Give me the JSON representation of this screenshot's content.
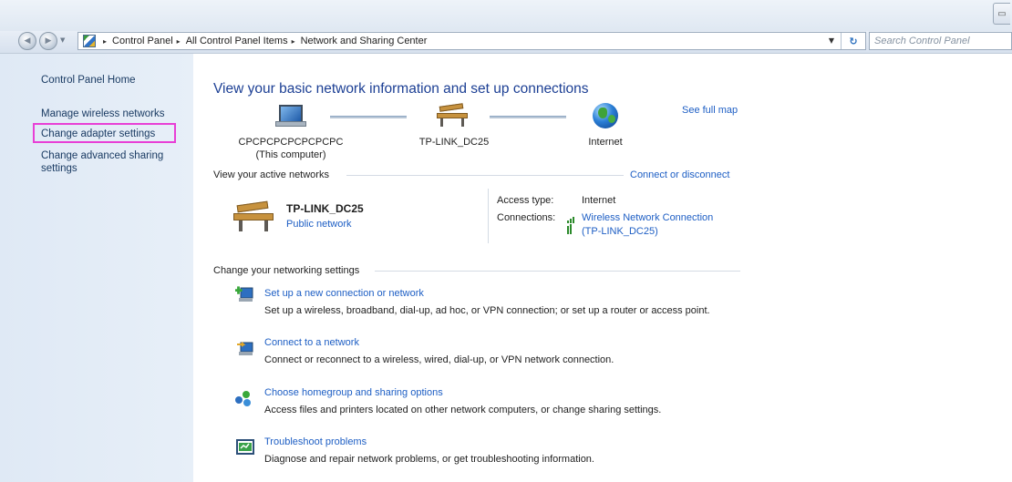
{
  "window": {
    "control_glyph": "▭"
  },
  "navigation": {
    "breadcrumb": [
      "Control Panel",
      "All Control Panel Items",
      "Network and Sharing Center"
    ],
    "separator": "▸",
    "search_placeholder": "Search Control Panel"
  },
  "sidebar": {
    "home": "Control Panel Home",
    "items": [
      {
        "label": "Manage wireless networks"
      },
      {
        "label": "Change adapter settings",
        "highlighted": true
      },
      {
        "label": "Change advanced sharing settings"
      }
    ],
    "highlight_color": "#e83fd6"
  },
  "main": {
    "title": "View your basic network information and set up connections",
    "see_full_map": "See full map",
    "map": {
      "computer_name": "CPCPCPCPCPCPCPC",
      "computer_sub": "(This computer)",
      "network_name": "TP-LINK_DC25",
      "internet_label": "Internet"
    },
    "active_networks": {
      "heading": "View your active networks",
      "connect_link": "Connect or disconnect",
      "network_name": "TP-LINK_DC25",
      "network_type": "Public network",
      "access_type_label": "Access type:",
      "access_type_value": "Internet",
      "connections_label": "Connections:",
      "connection_link_line1": "Wireless Network Connection",
      "connection_link_line2": "(TP-LINK_DC25)"
    },
    "settings": {
      "heading": "Change your networking settings",
      "tasks": [
        {
          "icon": "new-connection-icon",
          "title": "Set up a new connection or network",
          "description": "Set up a wireless, broadband, dial-up, ad hoc, or VPN connection; or set up a router or access point."
        },
        {
          "icon": "connect-network-icon",
          "title": "Connect to a network",
          "description": "Connect or reconnect to a wireless, wired, dial-up, or VPN network connection."
        },
        {
          "icon": "homegroup-icon",
          "title": "Choose homegroup and sharing options",
          "description": "Access files and printers located on other network computers, or change sharing settings."
        },
        {
          "icon": "troubleshoot-icon",
          "title": "Troubleshoot problems",
          "description": "Diagnose and repair network problems, or get troubleshooting information."
        }
      ]
    }
  },
  "colors": {
    "link": "#1d5ec4",
    "title": "#1c3f94",
    "sidebar_text": "#1a3b63"
  }
}
